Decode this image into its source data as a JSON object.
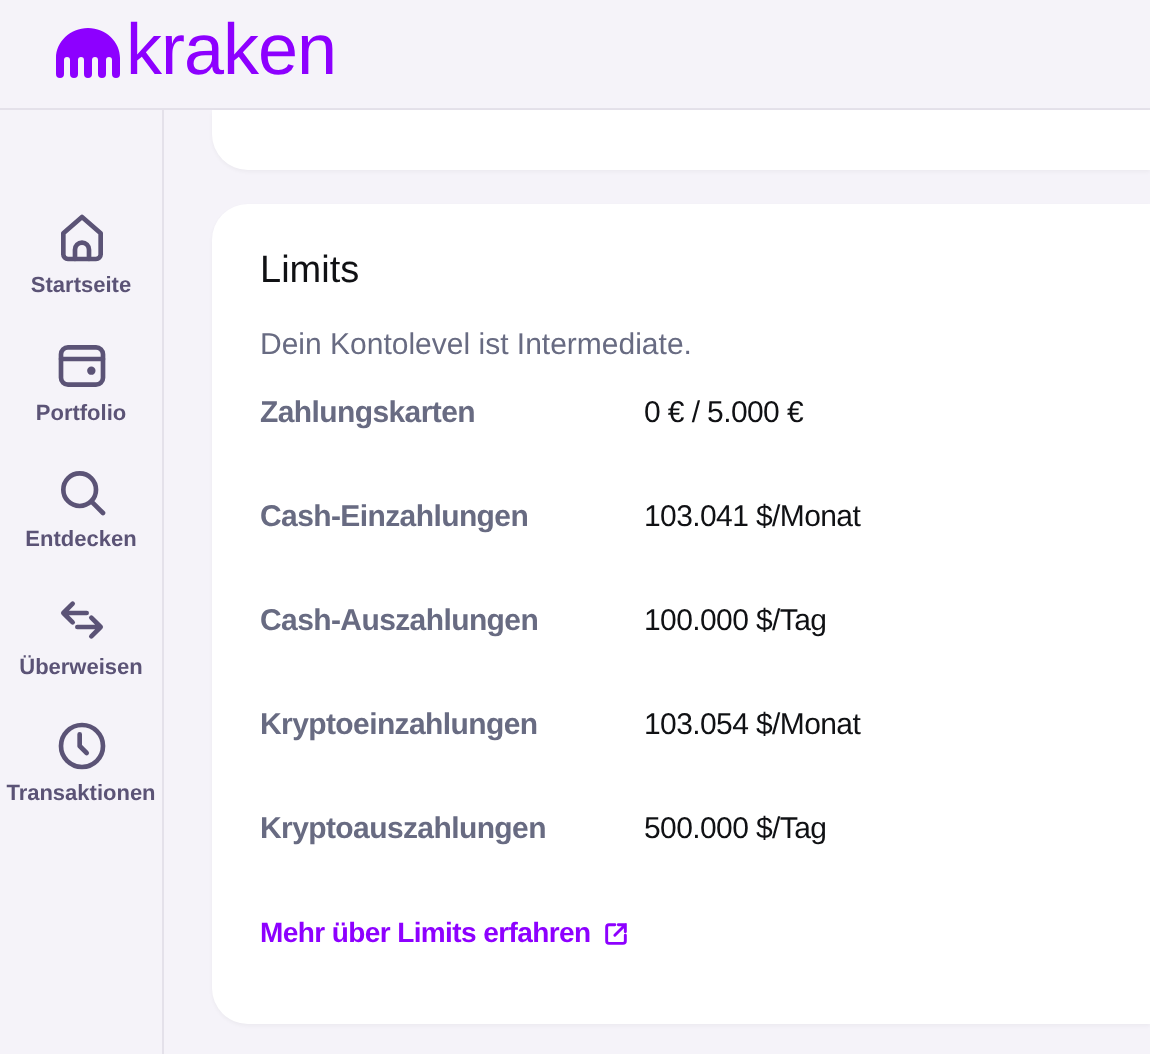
{
  "logo": "kraken",
  "sidebar": {
    "items": [
      {
        "label": "Startseite"
      },
      {
        "label": "Portfolio"
      },
      {
        "label": "Entdecken"
      },
      {
        "label": "Überweisen"
      },
      {
        "label": "Transaktionen"
      }
    ]
  },
  "limits": {
    "title": "Limits",
    "subtitle": "Dein Kontolevel ist Intermediate.",
    "rows": [
      {
        "label": "Zahlungskarten",
        "value": "0 € / 5.000 €"
      },
      {
        "label": "Cash-Einzahlungen",
        "value": "103.041 $/Monat"
      },
      {
        "label": "Cash-Auszahlungen",
        "value": "100.000 $/Tag"
      },
      {
        "label": "Kryptoeinzahlungen",
        "value": "103.054 $/Monat"
      },
      {
        "label": "Kryptoauszahlungen",
        "value": "500.000 $/Tag"
      }
    ],
    "link": "Mehr über Limits erfahren"
  }
}
